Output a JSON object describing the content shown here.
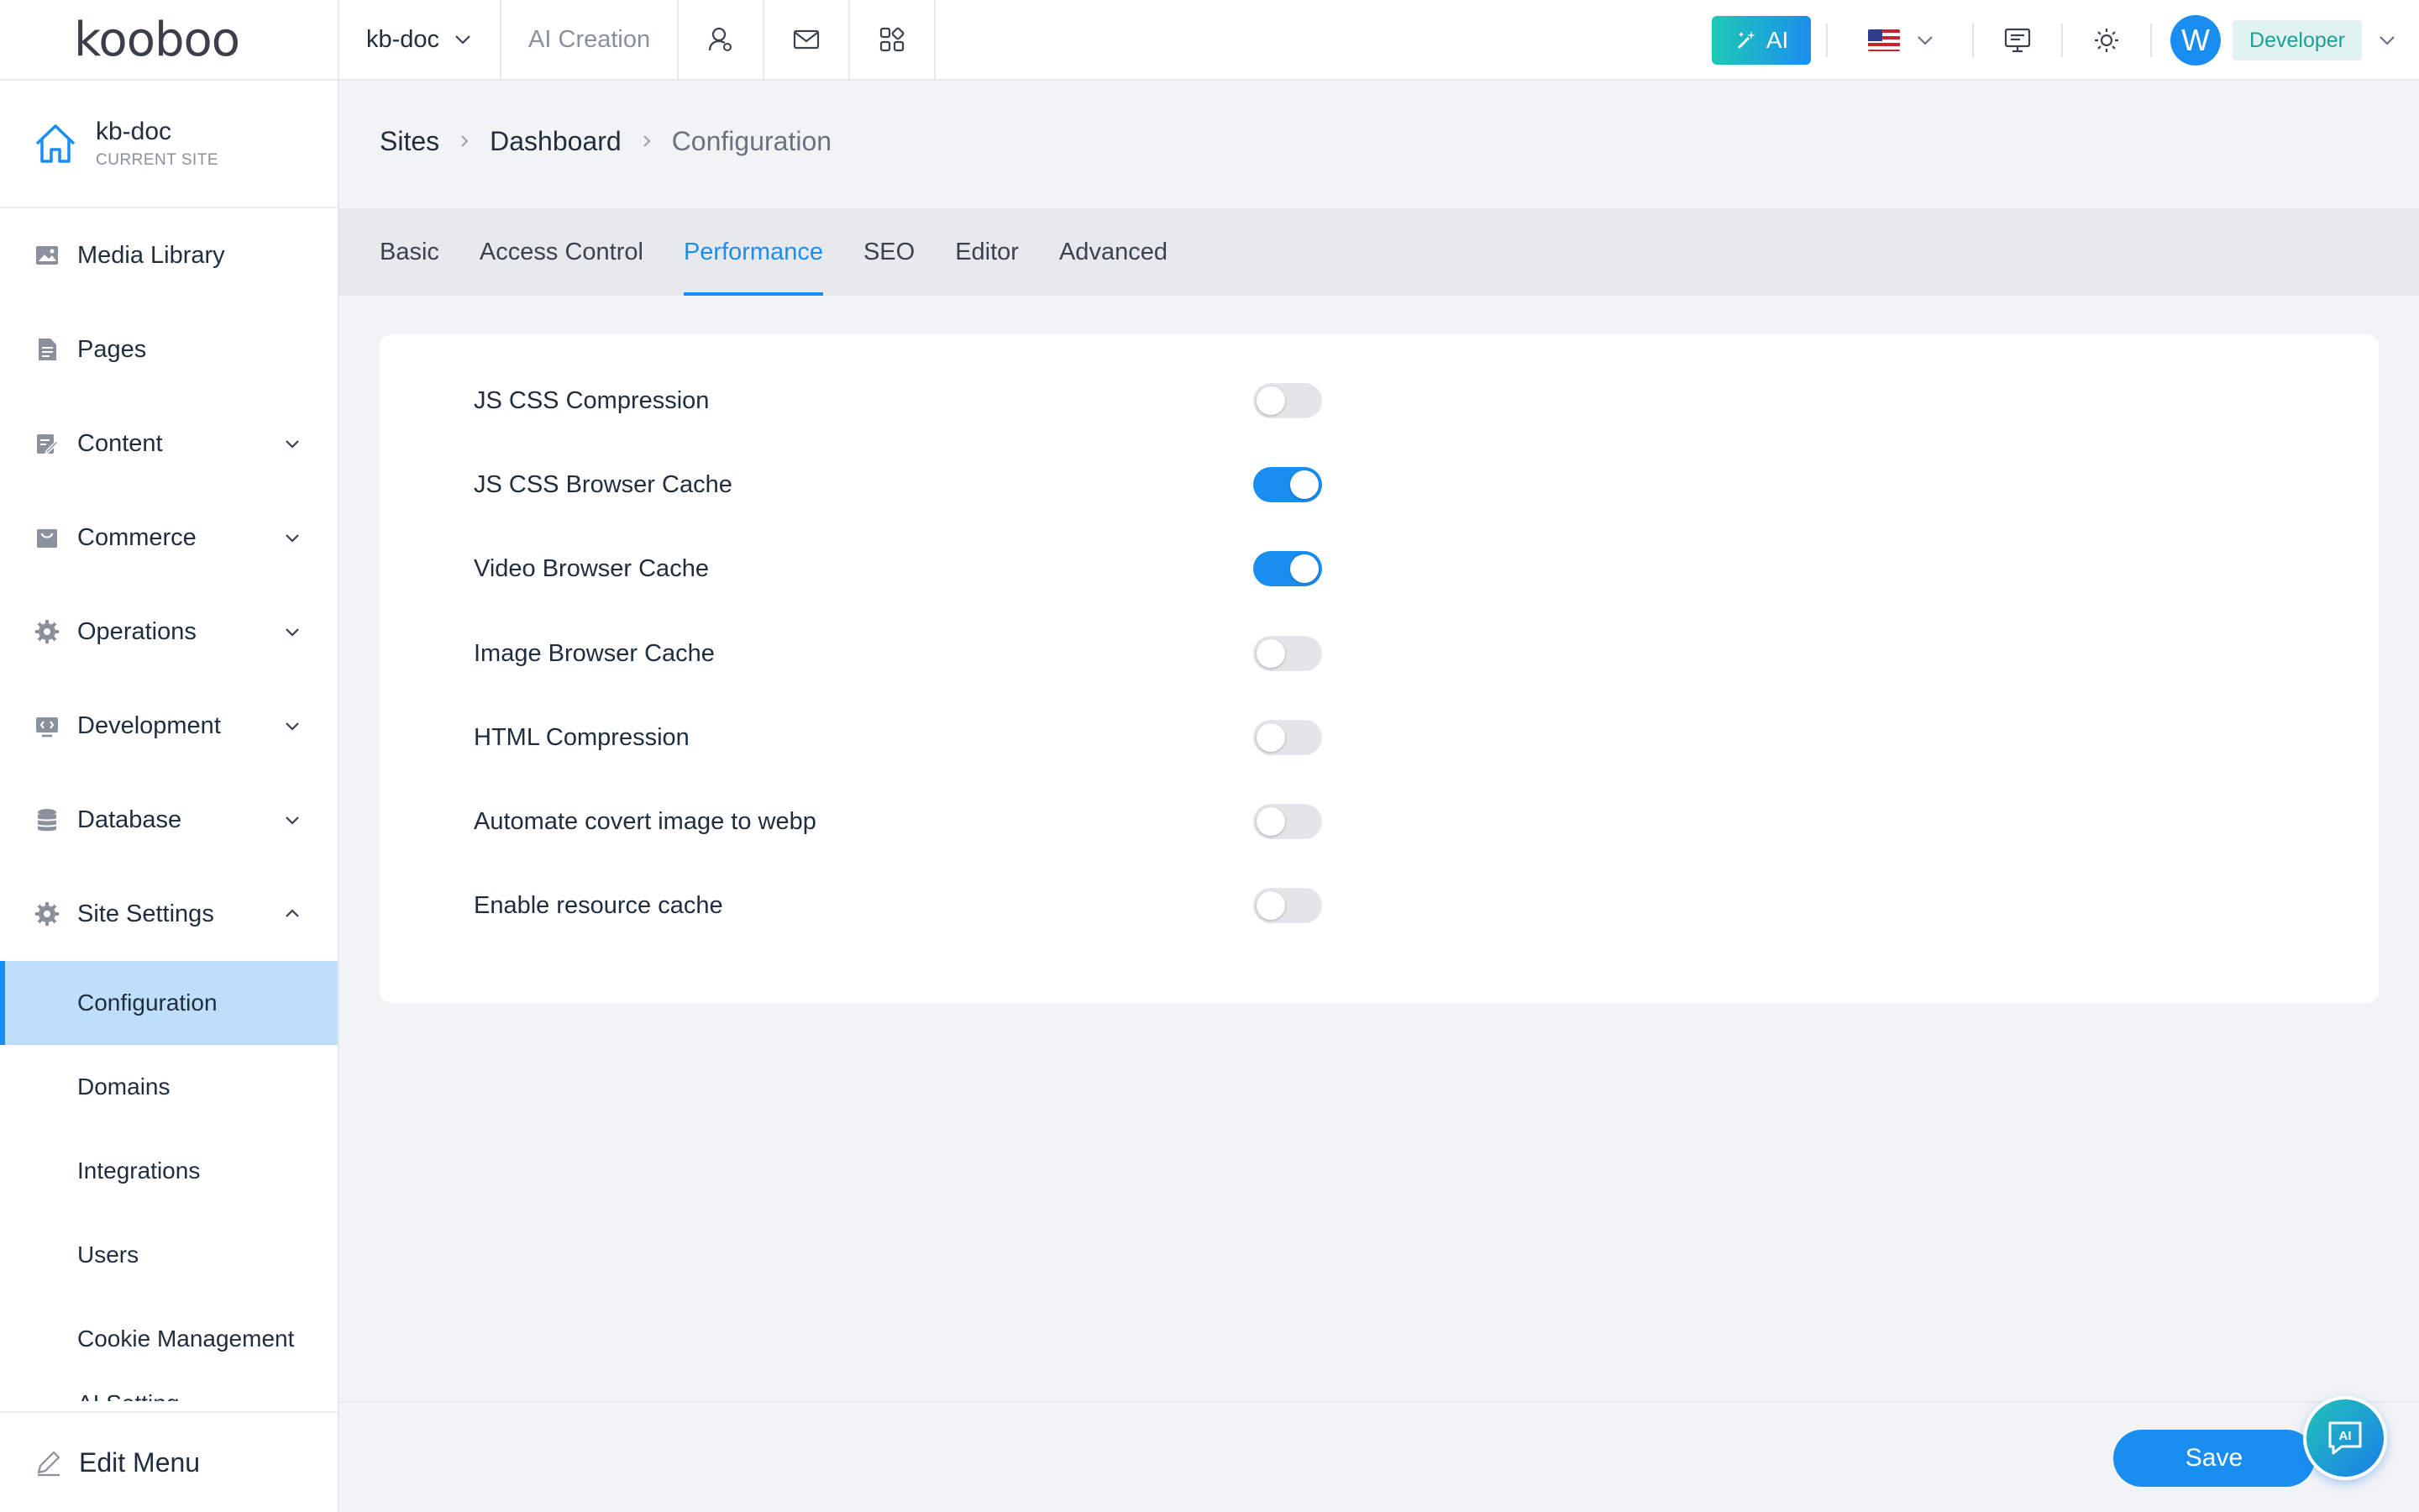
{
  "topbar": {
    "logo": "kooboo",
    "site_name": "kb-doc",
    "ai_creation": "AI Creation",
    "ai_button": "AI",
    "avatar_letter": "W",
    "role": "Developer"
  },
  "sidebar": {
    "current_site_name": "kb-doc",
    "current_site_sub": "CURRENT SITE",
    "items": [
      {
        "label": "Media Library",
        "icon": "image-icon"
      },
      {
        "label": "Pages",
        "icon": "document-icon"
      },
      {
        "label": "Content",
        "icon": "edit-doc-icon"
      },
      {
        "label": "Commerce",
        "icon": "bag-icon"
      },
      {
        "label": "Operations",
        "icon": "gear-icon"
      },
      {
        "label": "Development",
        "icon": "code-icon"
      },
      {
        "label": "Database",
        "icon": "database-icon"
      },
      {
        "label": "Site Settings",
        "icon": "gear-icon"
      }
    ],
    "sub_items": [
      "Configuration",
      "Domains",
      "Integrations",
      "Users",
      "Cookie Management"
    ],
    "sub_cut": "AI Setting",
    "edit_menu": "Edit Menu"
  },
  "breadcrumb": [
    "Sites",
    "Dashboard",
    "Configuration"
  ],
  "tabs": [
    "Basic",
    "Access Control",
    "Performance",
    "SEO",
    "Editor",
    "Advanced"
  ],
  "active_tab": "Performance",
  "settings": [
    {
      "label": "JS CSS Compression",
      "enabled": false
    },
    {
      "label": "JS CSS Browser Cache",
      "enabled": true
    },
    {
      "label": "Video Browser Cache",
      "enabled": true
    },
    {
      "label": "Image Browser Cache",
      "enabled": false
    },
    {
      "label": "HTML Compression",
      "enabled": false
    },
    {
      "label": "Automate covert image to webp",
      "enabled": false
    },
    {
      "label": "Enable resource cache",
      "enabled": false
    }
  ],
  "footer": {
    "save_label": "Save",
    "ai_float": "AI"
  },
  "colors": {
    "accent": "#1a8ef0",
    "active_bg": "#bfdef9",
    "ai_gradient_start": "#1ec9b5"
  }
}
